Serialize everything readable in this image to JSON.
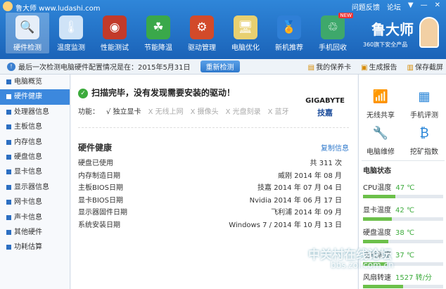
{
  "app": {
    "title": "鲁大师 www.ludashi.com",
    "top_links": [
      "问题反馈",
      "论坛",
      "▼",
      "—",
      "✕"
    ]
  },
  "nav": [
    {
      "label": "硬件检测",
      "icon": "🔍",
      "active": true,
      "color": "#e6eef8"
    },
    {
      "label": "温度监测",
      "icon": "🌡",
      "active": false,
      "color": "#cfe3f7"
    },
    {
      "label": "性能测试",
      "icon": "◉",
      "active": false,
      "color": "#c23a2a"
    },
    {
      "label": "节能降温",
      "icon": "☘",
      "active": false,
      "color": "#3aa84a"
    },
    {
      "label": "驱动管理",
      "icon": "⚙",
      "active": false,
      "color": "#d24a2a"
    },
    {
      "label": "电脑优化",
      "icon": "🖥",
      "active": false,
      "color": "#e8d070"
    },
    {
      "label": "新机推荐",
      "icon": "🏅",
      "active": false,
      "color": "#2f7fd6"
    },
    {
      "label": "手机回收",
      "icon": "♲",
      "active": false,
      "color": "#3ea86b",
      "badge": "NEW"
    }
  ],
  "brand": {
    "name": "鲁大师",
    "subtitle": "360旗下安全产品"
  },
  "infobar": {
    "text": "最后一次检测电脑硬件配置情况是在：2015年5月31日",
    "recheck": "重新检测",
    "links": [
      "我的保养卡",
      "生成报告",
      "保存截屏"
    ]
  },
  "sidebar": [
    "电脑概览",
    "硬件健康",
    "处理器信息",
    "主板信息",
    "内存信息",
    "硬盘信息",
    "显卡信息",
    "显示器信息",
    "网卡信息",
    "声卡信息",
    "其他硬件",
    "功耗估算"
  ],
  "sidebar_active": 1,
  "main": {
    "scan_msg": "扫描完毕，没有发现需要安装的驱动！",
    "func_label": "功能：",
    "func_items": [
      {
        "text": "√ 独立显卡",
        "on": true
      },
      {
        "text": "X 无线上网",
        "on": false
      },
      {
        "text": "X 摄像头",
        "on": false
      },
      {
        "text": "X 光盘刻录",
        "on": false
      },
      {
        "text": "X 蓝牙",
        "on": false
      }
    ],
    "vendor_en": "GIGABYTE",
    "vendor_cn": "技嘉",
    "hw_title": "硬件健康",
    "copy_label": "复制信息",
    "rows": [
      {
        "k": "硬盘已使用",
        "v": "共 311 次"
      },
      {
        "k": "内存制造日期",
        "v": "威刚 2014 年 08 月"
      },
      {
        "k": "主板BIOS日期",
        "v": "技嘉 2014 年 07 月 04 日"
      },
      {
        "k": "显卡BIOS日期",
        "v": "Nvidia 2014 年 06 月 17 日"
      },
      {
        "k": "显示器固件日期",
        "v": "飞利浦 2014 年 09 月"
      },
      {
        "k": "系统安装日期",
        "v": "Windows 7 / 2014 年 10 月 13 日"
      }
    ]
  },
  "tools": [
    {
      "label": "无线共享",
      "icon": "📶"
    },
    {
      "label": "手机评测",
      "icon": "▦"
    },
    {
      "label": "电脑维修",
      "icon": "🔧"
    },
    {
      "label": "挖矿指数",
      "icon": "₿"
    }
  ],
  "status": {
    "title": "电脑状态",
    "items": [
      {
        "label": "CPU温度",
        "value": "47 ℃",
        "level": 0.4
      },
      {
        "label": "显卡温度",
        "value": "42 ℃",
        "level": 0.36
      },
      {
        "label": "硬盘温度",
        "value": "38 ℃",
        "level": 0.32
      },
      {
        "label": "主板温度",
        "value": "37 ℃",
        "level": 0.3
      },
      {
        "label": "风扇转速",
        "value": "1527 转/分",
        "level": 0.5
      }
    ]
  },
  "watermark": {
    "text": "中关村在线论坛",
    "url": "bbs.zol.com.cn"
  }
}
